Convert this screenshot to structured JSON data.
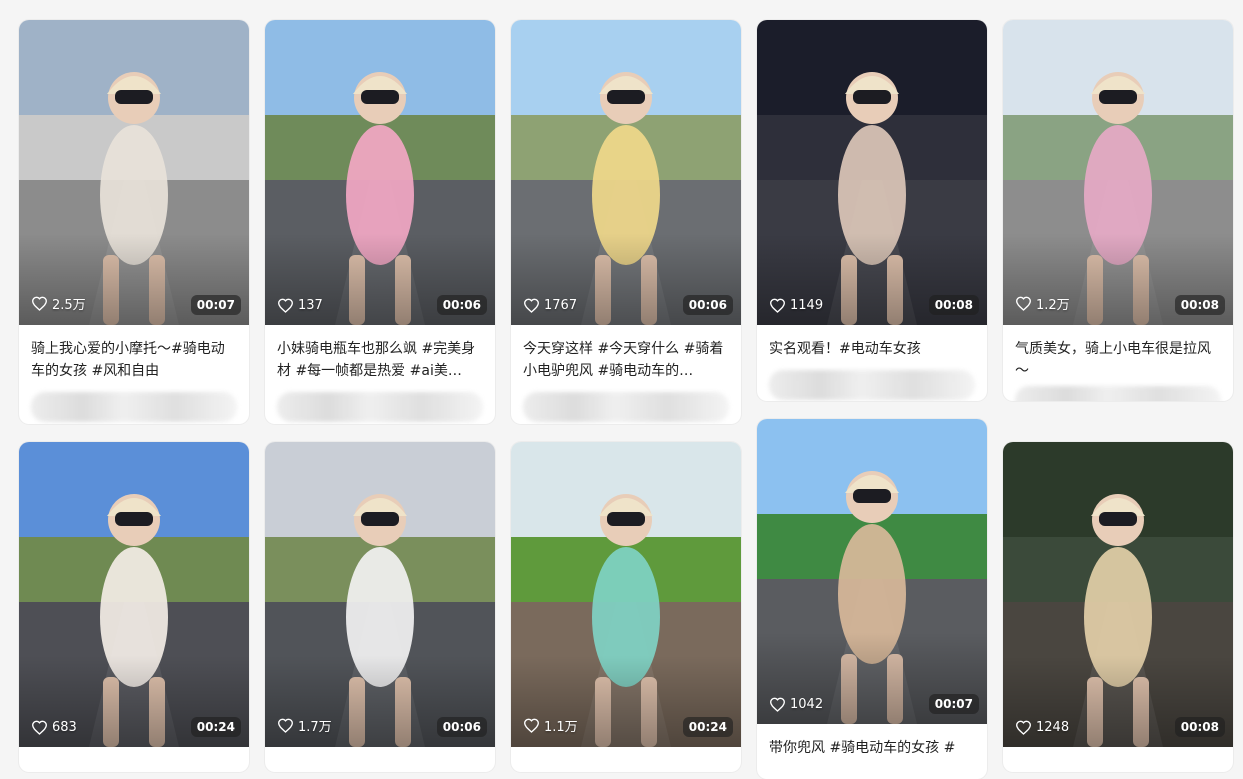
{
  "cards": [
    {
      "likes": "2.5万",
      "duration": "00:07",
      "caption": "骑上我心爱的小摩托～#骑电动车的女孩 #风和自由",
      "palette": {
        "sky": "#9fb2c7",
        "mid": "#c9c9c9",
        "ground": "#8c8c8c",
        "figure": "#e8e2d9"
      }
    },
    {
      "likes": "137",
      "duration": "00:06",
      "caption": "小妹骑电瓶车也那么飒 #完美身材 #每一帧都是热爱 #ai美…",
      "palette": {
        "sky": "#8fbce6",
        "mid": "#6f8b5a",
        "ground": "#5b5e63",
        "figure": "#f2a7c3"
      }
    },
    {
      "likes": "1767",
      "duration": "00:06",
      "caption": "今天穿这样 #今天穿什么 #骑着小电驴兜风 #骑电动车的…",
      "palette": {
        "sky": "#a8d0f0",
        "mid": "#8ea273",
        "ground": "#6b6e72",
        "figure": "#f0d88a"
      }
    },
    {
      "likes": "1149",
      "duration": "00:08",
      "caption": "实名观看！#电动车女孩",
      "palette": {
        "sky": "#1b1d2a",
        "mid": "#2e2f3a",
        "ground": "#3a3b44",
        "figure": "#dcc7b8"
      }
    },
    {
      "likes": "1.2万",
      "duration": "00:08",
      "caption": "气质美女，骑上小电车很是拉风～",
      "palette": {
        "sky": "#d8e3ec",
        "mid": "#8aa383",
        "ground": "#8d8d8d",
        "figure": "#e6a9c6"
      }
    },
    {
      "likes": "683",
      "duration": "00:24",
      "caption": "",
      "palette": {
        "sky": "#5b8fd8",
        "mid": "#6f8a52",
        "ground": "#4e4f55",
        "figure": "#f3ede6"
      }
    },
    {
      "likes": "1.7万",
      "duration": "00:06",
      "caption": "",
      "palette": {
        "sky": "#c9ced6",
        "mid": "#7a8f5c",
        "ground": "#515459",
        "figure": "#f2f2f2"
      }
    },
    {
      "likes": "1.1万",
      "duration": "00:24",
      "caption": "",
      "palette": {
        "sky": "#d9e6ea",
        "mid": "#5f9a3c",
        "ground": "#7a6a5c",
        "figure": "#7fd3c4"
      }
    },
    {
      "likes": "1042",
      "duration": "00:07",
      "caption": "带你兜风 #骑电动车的女孩 #",
      "palette": {
        "sky": "#8cc1f0",
        "mid": "#3f8a43",
        "ground": "#5a5c60",
        "figure": "#d8b99a"
      }
    },
    {
      "likes": "1248",
      "duration": "00:08",
      "caption": "",
      "palette": {
        "sky": "#2c3a2a",
        "mid": "#3b4a3a",
        "ground": "#4a4640",
        "figure": "#e3cfa8"
      }
    }
  ]
}
